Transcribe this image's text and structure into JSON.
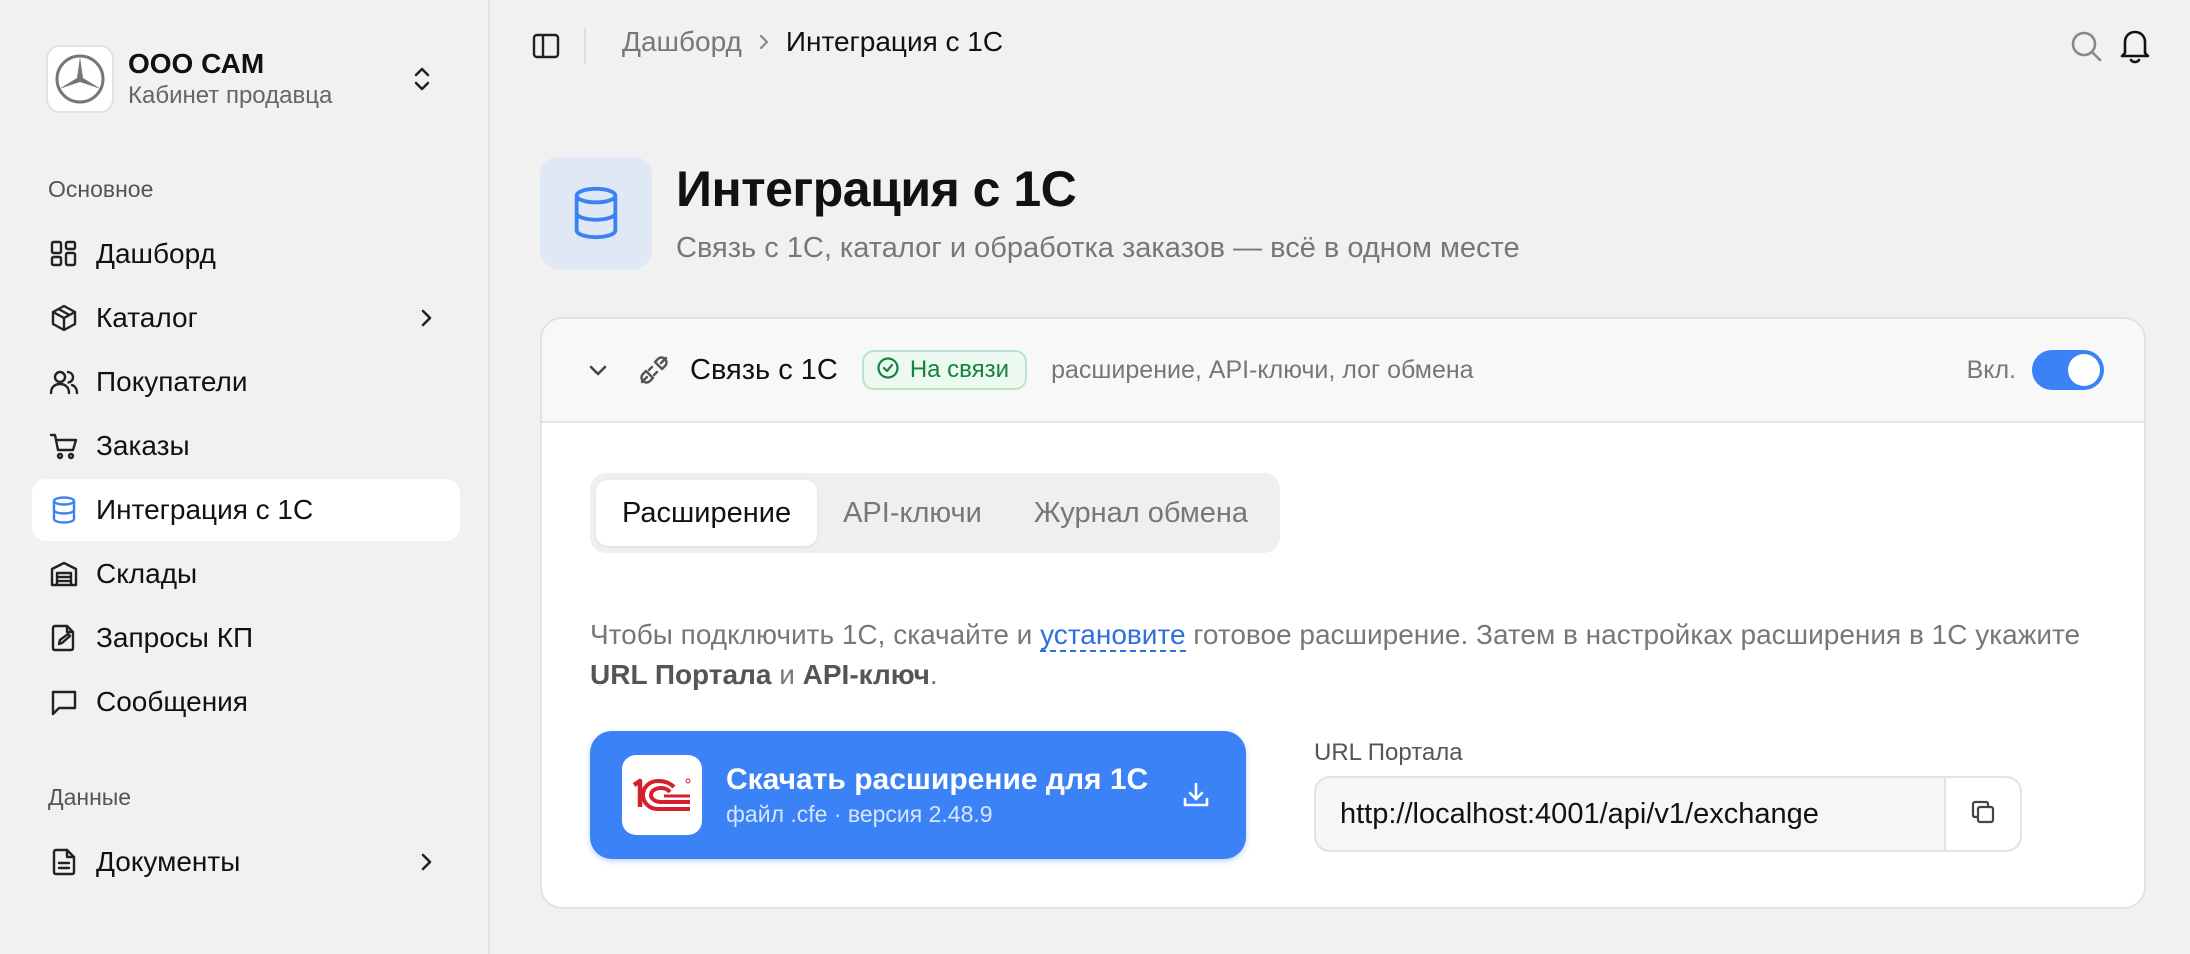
{
  "brand": {
    "name": "ООО САМ",
    "subtitle": "Кабинет продавца"
  },
  "sidebar": {
    "section_main": "Основное",
    "section_data": "Данные",
    "items": [
      {
        "label": "Дашборд",
        "icon": "dashboard-icon"
      },
      {
        "label": "Каталог",
        "icon": "box-icon",
        "has_children": true
      },
      {
        "label": "Покупатели",
        "icon": "users-icon"
      },
      {
        "label": "Заказы",
        "icon": "cart-icon"
      },
      {
        "label": "Интеграция с 1С",
        "icon": "database-icon",
        "active": true
      },
      {
        "label": "Склады",
        "icon": "warehouse-icon"
      },
      {
        "label": "Запросы КП",
        "icon": "file-edit-icon"
      },
      {
        "label": "Сообщения",
        "icon": "message-icon"
      }
    ],
    "data_items": [
      {
        "label": "Документы",
        "icon": "document-icon",
        "has_children": true
      }
    ]
  },
  "breadcrumb": {
    "parent": "Дашборд",
    "current": "Интеграция с 1С"
  },
  "page": {
    "title": "Интеграция с 1С",
    "subtitle": "Связь с 1С, каталог и обработка заказов — всё в одном месте"
  },
  "card": {
    "title": "Связь с 1С",
    "status": "На связи",
    "description": "расширение, API-ключи, лог обмена",
    "switch_label": "Вкл.",
    "enabled": true,
    "tabs": [
      "Расширение",
      "API-ключи",
      "Журнал обмена"
    ],
    "active_tab": 0,
    "info": {
      "part1": "Чтобы подключить 1С, скачайте и ",
      "link": "установите",
      "part2": " готовое расширение. Затем в настройках расширения в 1С укажите ",
      "bold1": "URL Портала",
      "part3": " и ",
      "bold2": "API-ключ",
      "part4": "."
    },
    "download": {
      "title": "Скачать расширение для 1С",
      "subtitle": "файл .cfe · версия 2.48.9"
    },
    "url_label": "URL Портала",
    "url_value": "http://localhost:4001/api/v1/exchange"
  },
  "colors": {
    "accent": "#3b82f6",
    "status_green": "#14833d",
    "onec_red": "#d4202a"
  }
}
